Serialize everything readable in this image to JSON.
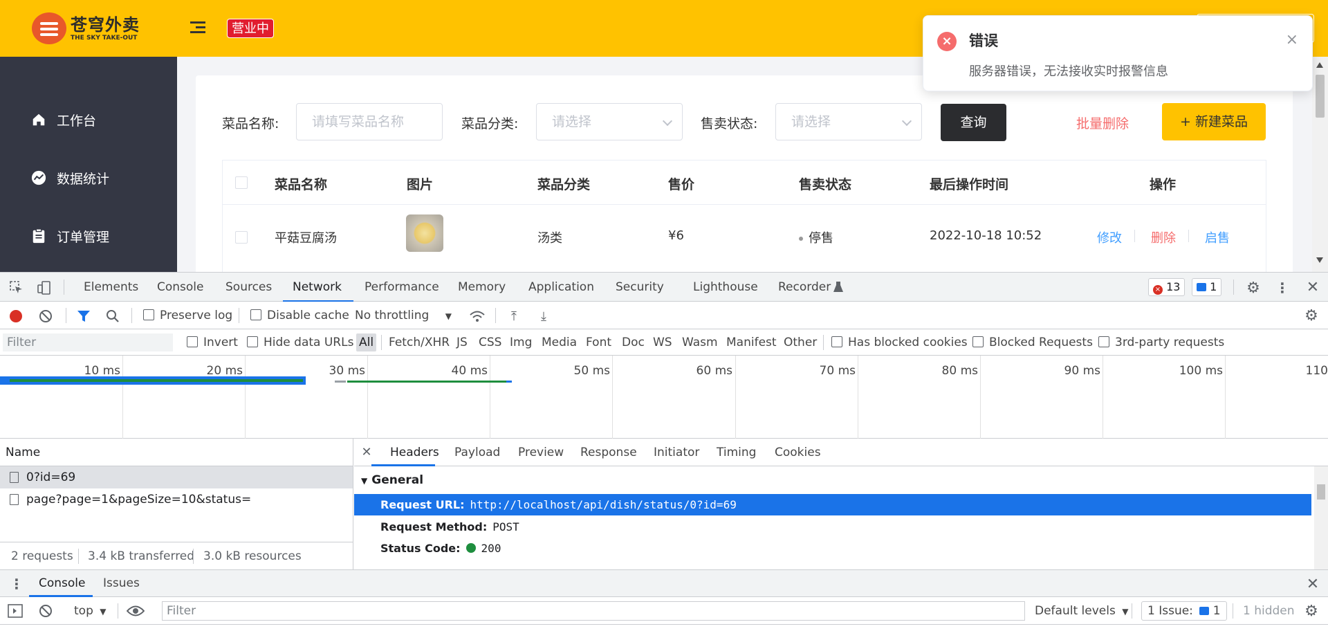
{
  "app": {
    "logo": {
      "cn": "苍穹外卖",
      "en": "THE SKY TAKE-OUT"
    },
    "status_tag": "营业中",
    "sidebar": [
      {
        "label": "工作台",
        "icon": "home-icon"
      },
      {
        "label": "数据统计",
        "icon": "chart-icon"
      },
      {
        "label": "订单管理",
        "icon": "clipboard-icon"
      }
    ],
    "filters": {
      "name_label": "菜品名称:",
      "name_placeholder": "请填写菜品名称",
      "category_label": "菜品分类:",
      "category_placeholder": "请选择",
      "status_label": "售卖状态:",
      "status_placeholder": "请选择",
      "query_button": "查询",
      "batch_delete": "批量删除",
      "new_dish": "+ 新建菜品"
    },
    "table": {
      "headers": [
        "菜品名称",
        "图片",
        "菜品分类",
        "售价",
        "售卖状态",
        "最后操作时间",
        "操作"
      ],
      "rows": [
        {
          "name": "平菇豆腐汤",
          "category": "汤类",
          "price": "¥6",
          "status": "停售",
          "time": "2022-10-18 10:52",
          "ops": {
            "edit": "修改",
            "delete": "删除",
            "enable": "启售"
          }
        }
      ]
    },
    "toast": {
      "title": "错误",
      "message": "服务器错误，无法接收实时报警信息",
      "close": "×"
    }
  },
  "devtools": {
    "tabs": [
      "Elements",
      "Console",
      "Sources",
      "Network",
      "Performance",
      "Memory",
      "Application",
      "Security",
      "Lighthouse",
      "Recorder"
    ],
    "active_tab": "Network",
    "error_count": "13",
    "issue_count": "1",
    "toolbar": {
      "preserve_log": "Preserve log",
      "disable_cache": "Disable cache",
      "throttling": "No throttling"
    },
    "filterbar": {
      "placeholder": "Filter",
      "invert": "Invert",
      "hide_data_urls": "Hide data URLs",
      "types": [
        "All",
        "Fetch/XHR",
        "JS",
        "CSS",
        "Img",
        "Media",
        "Font",
        "Doc",
        "WS",
        "Wasm",
        "Manifest",
        "Other"
      ],
      "has_blocked_cookies": "Has blocked cookies",
      "blocked_requests": "Blocked Requests",
      "third_party": "3rd-party requests"
    },
    "timeline_labels": [
      "10 ms",
      "20 ms",
      "30 ms",
      "40 ms",
      "50 ms",
      "60 ms",
      "70 ms",
      "80 ms",
      "90 ms",
      "100 ms",
      "110"
    ],
    "requests": {
      "header": "Name",
      "items": [
        "0?id=69",
        "page?page=1&pageSize=10&status="
      ],
      "summary": {
        "requests": "2 requests",
        "transferred": "3.4 kB transferred",
        "resources": "3.0 kB resources"
      }
    },
    "details": {
      "tabs": [
        "Headers",
        "Payload",
        "Preview",
        "Response",
        "Initiator",
        "Timing",
        "Cookies"
      ],
      "general_label": "General",
      "rows": [
        {
          "key": "Request URL:",
          "value": "http://localhost/api/dish/status/0?id=69"
        },
        {
          "key": "Request Method:",
          "value": "POST"
        },
        {
          "key": "Status Code:",
          "value": "200"
        }
      ]
    },
    "drawer": {
      "tabs": [
        "Console",
        "Issues"
      ]
    },
    "console": {
      "context": "top",
      "filter_placeholder": "Filter",
      "levels": "Default levels",
      "issues": "1 Issue:",
      "issue_count": "1",
      "hidden": "1 hidden"
    }
  }
}
